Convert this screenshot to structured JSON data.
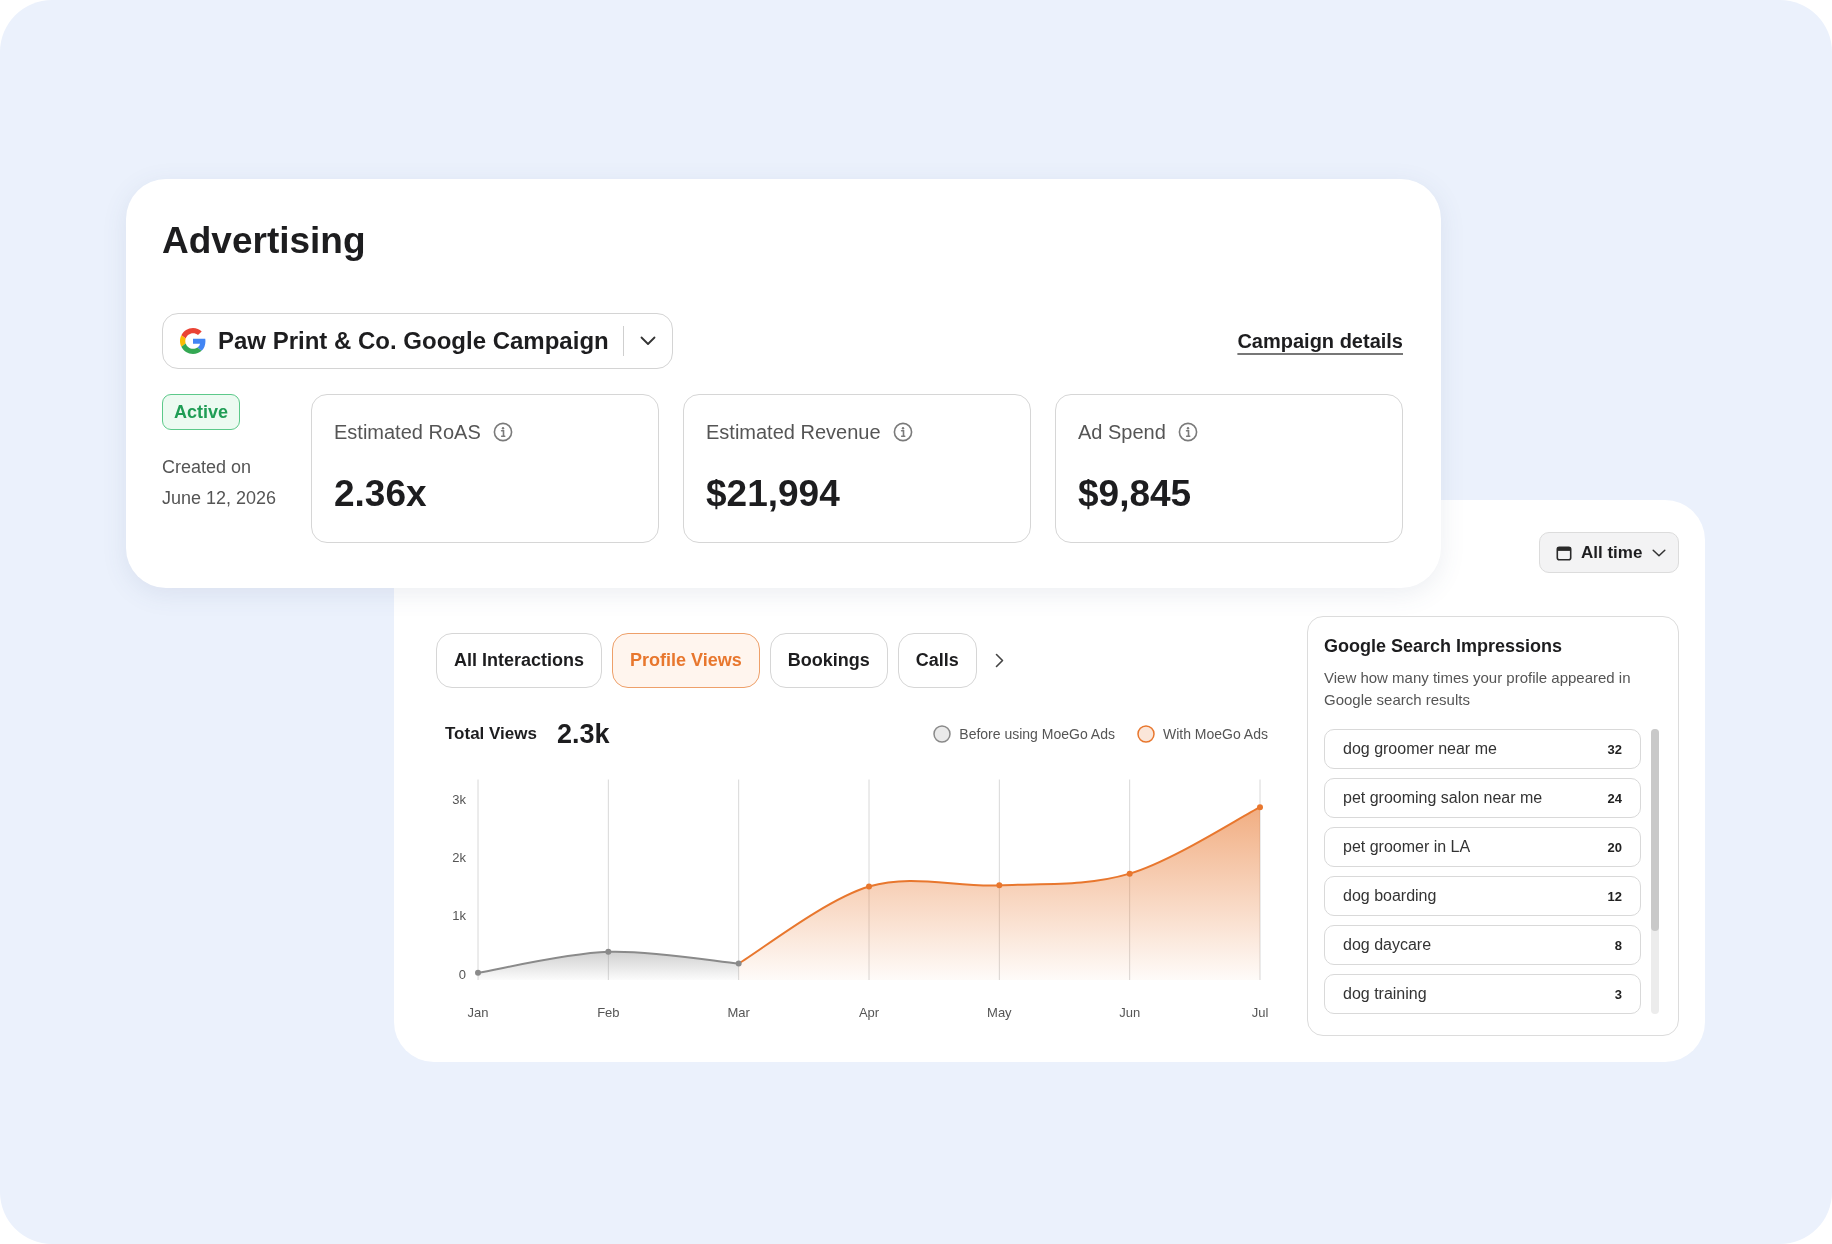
{
  "page_title": "Advertising",
  "campaign_select": {
    "value": "Paw Print & Co. Google Campaign"
  },
  "campaign_link": "Campaign details",
  "status": "Active",
  "created": {
    "label": "Created on",
    "date": "June 12, 2026"
  },
  "metrics": [
    {
      "label": "Estimated RoAS",
      "value": "2.36x"
    },
    {
      "label": "Estimated Revenue",
      "value": "$21,994"
    },
    {
      "label": "Ad Spend",
      "value": "$9,845"
    }
  ],
  "date_filter": {
    "value": "All time"
  },
  "tabs": [
    {
      "label": "All Interactions",
      "selected": false
    },
    {
      "label": "Profile Views",
      "selected": true
    },
    {
      "label": "Bookings",
      "selected": false
    },
    {
      "label": "Calls",
      "selected": false
    }
  ],
  "chart": {
    "total_label": "Total Views",
    "total_value": "2.3k",
    "chart_data": {
      "type": "area",
      "categories": [
        "Jan",
        "Feb",
        "Mar",
        "Apr",
        "May",
        "Jun",
        "Jul"
      ],
      "series": [
        {
          "name": "Before using MoeGo Ads",
          "color": "#8a8a8a",
          "values": [
            20,
            380,
            180,
            null,
            null,
            null,
            null
          ]
        },
        {
          "name": "With MoeGo Ads",
          "color": "#e8772e",
          "values": [
            null,
            null,
            180,
            1500,
            1520,
            1720,
            2860
          ]
        }
      ],
      "ylim": [
        0,
        3300
      ],
      "yticks": [
        0,
        {
          "value": 1000,
          "label": "1k"
        },
        {
          "value": 2000,
          "label": "2k"
        },
        {
          "value": 3000,
          "label": "3k"
        }
      ],
      "grid": true
    }
  },
  "impressions": {
    "title": "Google Search Impressions",
    "description": "View how many times your profile appeared in Google search results",
    "rows": [
      {
        "query": "dog groomer near me",
        "count": "32"
      },
      {
        "query": "pet grooming salon near me",
        "count": "24"
      },
      {
        "query": "pet groomer in LA",
        "count": "20"
      },
      {
        "query": "dog boarding",
        "count": "12"
      },
      {
        "query": "dog daycare",
        "count": "8"
      },
      {
        "query": "dog training",
        "count": "3"
      }
    ]
  }
}
